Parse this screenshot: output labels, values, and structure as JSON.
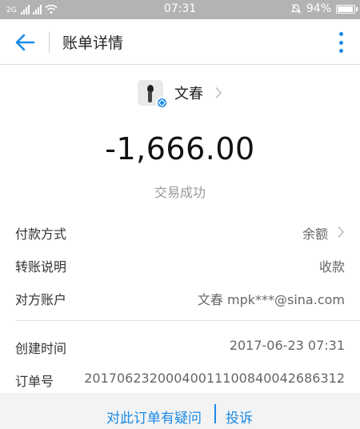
{
  "status_bar": {
    "network_label": "2G",
    "time": "07:31",
    "battery_percent": "94%",
    "battery_level": 0.94
  },
  "nav": {
    "title": "账单详情"
  },
  "payee": {
    "name": "文春"
  },
  "amount": "-1,666.00",
  "transaction_status": "交易成功",
  "details": [
    {
      "label": "付款方式",
      "value": "余额"
    },
    {
      "label": "转账说明",
      "value": "收款"
    },
    {
      "label": "对方账户",
      "value": "文春 mpk***@sina.com"
    },
    {
      "label": "创建时间",
      "value": "2017-06-23 07:31"
    },
    {
      "label": "订单号",
      "value": "20170623200040011100840042686312"
    }
  ],
  "footer": {
    "question_link": "对此订单有疑问",
    "complaint_link": "投诉"
  },
  "colors": {
    "accent": "#1a8ae6",
    "status_bar": "#b3b3b3"
  }
}
